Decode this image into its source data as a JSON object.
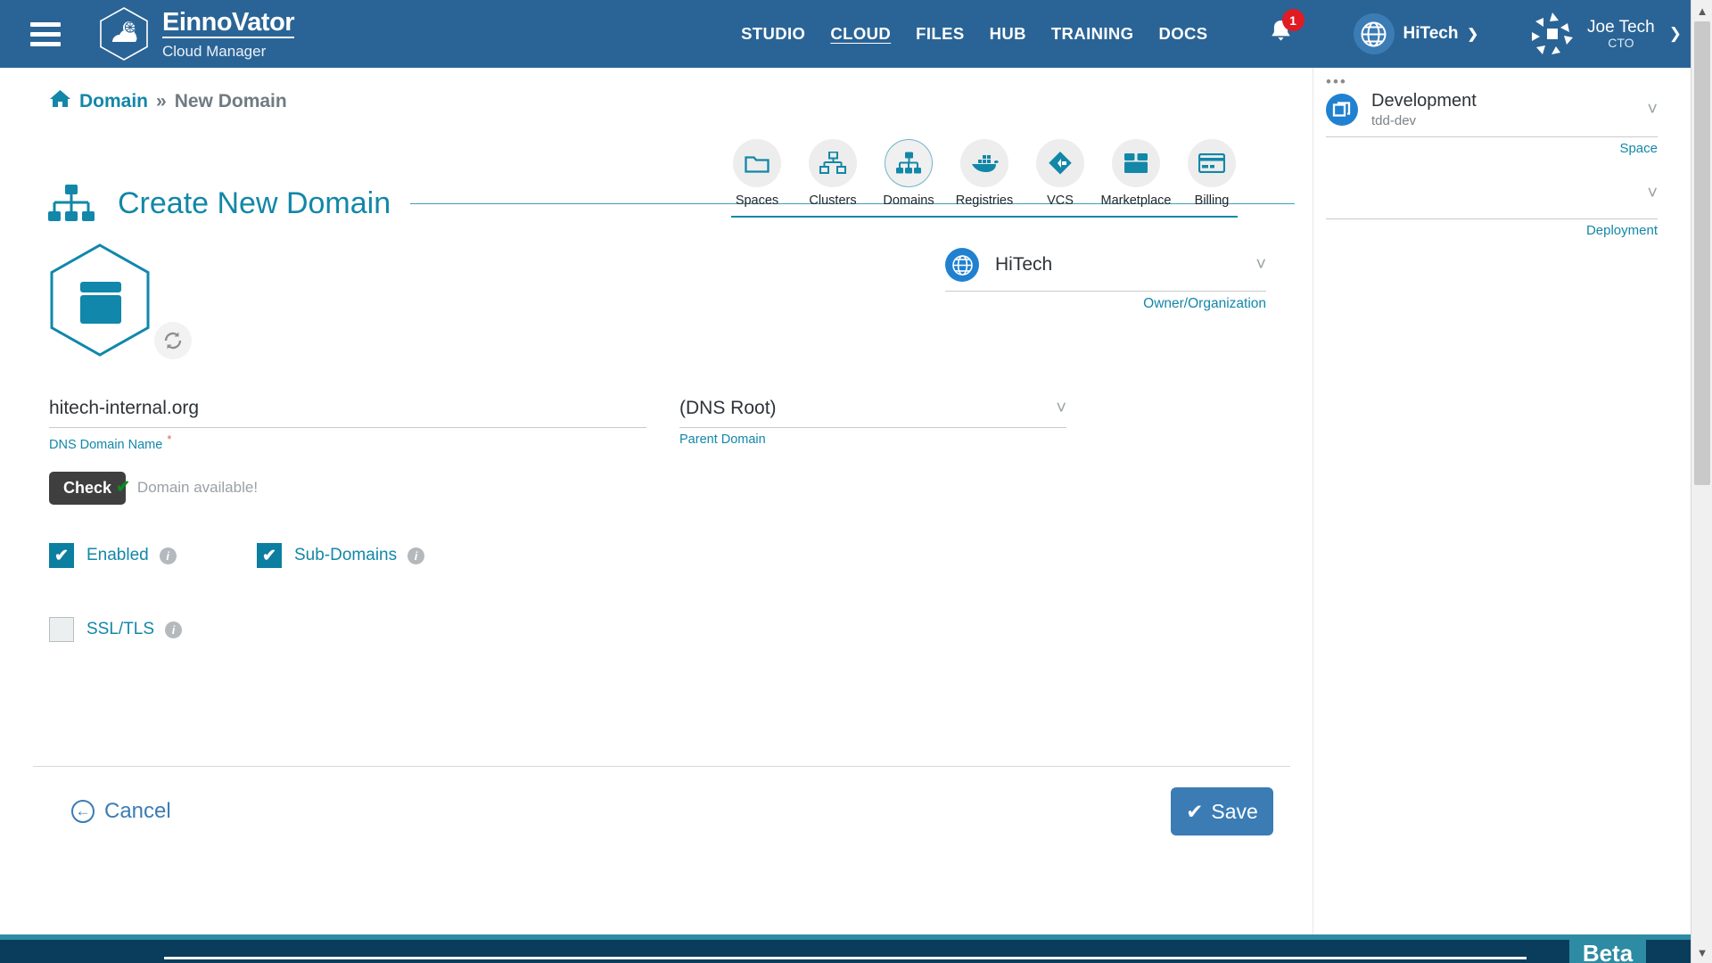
{
  "header": {
    "menu_icon": "hamburger-icon",
    "brand_title": "EinnoVator",
    "brand_subtitle": "Cloud Manager",
    "nav": [
      {
        "label": "STUDIO",
        "active": false
      },
      {
        "label": "CLOUD",
        "active": true
      },
      {
        "label": "FILES",
        "active": false
      },
      {
        "label": "HUB",
        "active": false
      },
      {
        "label": "TRAINING",
        "active": false
      },
      {
        "label": "DOCS",
        "active": false
      }
    ],
    "notifications": {
      "icon": "bell-icon",
      "count": "1"
    },
    "org": {
      "icon": "globe-icon",
      "name": "HiTech",
      "chevron": "chevron-down-icon"
    },
    "user": {
      "avatar": "user-avatar",
      "name": "Joe Tech",
      "role": "CTO",
      "chevron": "chevron-down-icon"
    }
  },
  "breadcrumb": {
    "home_icon": "home-icon",
    "parent": "Domain",
    "separator": "»",
    "current": "New Domain"
  },
  "page": {
    "icon": "domain-tree-icon",
    "title": "Create New Domain"
  },
  "toolbar": [
    {
      "label": "Spaces",
      "icon": "folder-icon",
      "selected": false
    },
    {
      "label": "Clusters",
      "icon": "cluster-icon",
      "selected": false
    },
    {
      "label": "Domains",
      "icon": "domain-tree-icon",
      "selected": true
    },
    {
      "label": "Registries",
      "icon": "docker-whale-icon",
      "selected": false
    },
    {
      "label": "VCS",
      "icon": "vcs-diamond-icon",
      "selected": false
    },
    {
      "label": "Marketplace",
      "icon": "box-icon",
      "selected": false
    },
    {
      "label": "Billing",
      "icon": "credit-card-icon",
      "selected": false
    }
  ],
  "form": {
    "avatar_icon": "domain-hex-icon",
    "refresh_icon": "refresh-icon",
    "owner": {
      "icon": "globe-icon",
      "value": "HiTech",
      "caption": "Owner/Organization",
      "chevron": "chevron-down-icon"
    },
    "dns_domain": {
      "value": "hitech-internal.org",
      "caption": "DNS Domain Name",
      "required_marker": "*",
      "placeholder": "DNS Domain Name"
    },
    "parent_domain": {
      "value": "(DNS Root)",
      "caption": "Parent Domain",
      "chevron": "chevron-down-icon"
    },
    "check_button": "Check",
    "availability": {
      "icon": "check-mark-icon",
      "text": "Domain available!"
    },
    "checkboxes": [
      {
        "label": "Enabled",
        "checked": true,
        "info_icon": "info-icon"
      },
      {
        "label": "Sub-Domains",
        "checked": true,
        "info_icon": "info-icon"
      },
      {
        "label": "SSL/TLS",
        "checked": false,
        "info_icon": "info-icon"
      }
    ]
  },
  "footer": {
    "cancel_label": "Cancel",
    "cancel_icon": "arrow-left-circle-icon",
    "save_label": "Save",
    "save_icon": "check-mark-icon"
  },
  "rightpanel": {
    "dots": "•••",
    "space": {
      "icon": "space-icon",
      "name": "Development",
      "sub": "tdd-dev",
      "caption": "Space",
      "chevron": "chevron-down-icon"
    },
    "deployment": {
      "name": "",
      "caption": "Deployment",
      "chevron": "chevron-down-icon"
    }
  },
  "taskbar": {
    "beta_label": "Beta"
  },
  "colors": {
    "header_blue": "#2a6496",
    "accent_teal": "#1287a8",
    "checkbox_teal": "#0c7ea0",
    "save_blue": "#3b7cb5",
    "badge_red": "#e01b24",
    "success_green": "#0a8a24"
  }
}
